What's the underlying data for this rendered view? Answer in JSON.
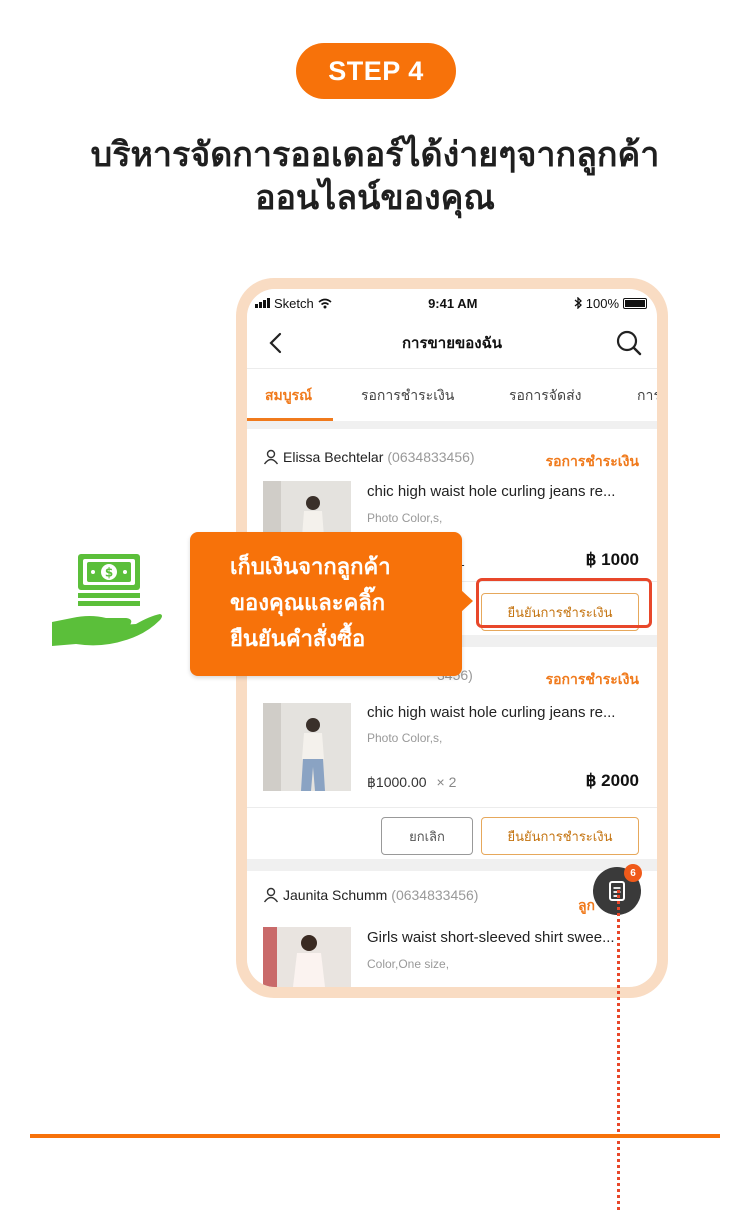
{
  "step_label": "STEP 4",
  "headline": {
    "line1": "บริหารจัดการออเดอร์ได้ง่ายๆจากลูกค้า",
    "line2": "ออนไลน์ของคุณ"
  },
  "colors": {
    "accent": "#f7720a",
    "status_orange": "#f07a1c",
    "highlight_red": "#e8472a",
    "money_green": "#5bbf3a"
  },
  "status_bar": {
    "carrier": "Sketch",
    "time": "9:41 AM",
    "battery": "100%"
  },
  "nav": {
    "title": "การขายของฉัน",
    "back_icon": "chevron-left-icon",
    "search_icon": "search-icon"
  },
  "tabs": [
    {
      "label": "สมบูรณ์",
      "active": true
    },
    {
      "label": "รอการชำระเงิน",
      "active": false
    },
    {
      "label": "รอการจัดส่ง",
      "active": false
    },
    {
      "label": "การ",
      "active": false
    }
  ],
  "orders": [
    {
      "customer": "Elissa Bechtelar",
      "phone": "(0634833456)",
      "status": "รอการชำระเงิน",
      "product": "chic high waist hole curling jeans re...",
      "variant": "Photo Color,s,",
      "qty_fragment": "1",
      "total": "฿ 1000",
      "confirm_label": "ยืนยันการชำระเงิน"
    },
    {
      "phone_fragment": "3456)",
      "status": "รอการชำระเงิน",
      "product": "chic high waist hole curling jeans re...",
      "variant": "Photo Color,s,",
      "unit_price": "฿1000.00",
      "qty": "× 2",
      "total": "฿ 2000",
      "cancel_label": "ยกเลิก",
      "confirm_label": "ยืนยันการชำระเงิน"
    },
    {
      "customer": "Jaunita Schumm",
      "phone": "(0634833456)",
      "status_fragment": "ลูก",
      "product": "Girls waist short-sleeved shirt swee...",
      "variant": "Color,One size,"
    }
  ],
  "fab": {
    "icon": "order-list-icon",
    "badge": "6"
  },
  "callout": {
    "line1": "เก็บเงินจากลูกค้า",
    "line2": "ของคุณและคลิ๊ก",
    "line3": "ยืนยันคำสั่งซื้อ"
  },
  "illustration_icon": "money-hand-icon"
}
